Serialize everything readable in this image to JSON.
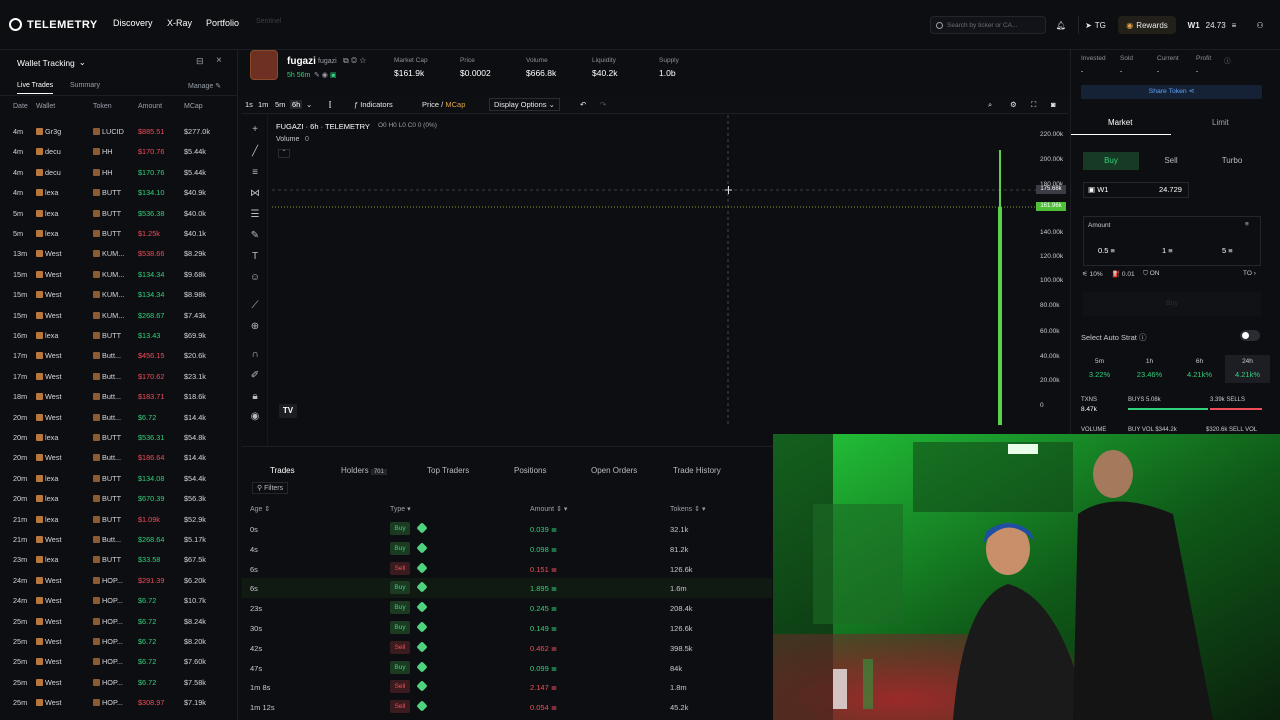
{
  "app": {
    "name": "TELEMETRY"
  },
  "nav": {
    "items": [
      "Discovery",
      "X-Ray",
      "Portfolio"
    ],
    "dim_item": "Sentinel"
  },
  "search": {
    "placeholder": "Search by ticker or CA..."
  },
  "header_right": {
    "tg": "TG",
    "rewards": "Rewards",
    "wallet": "W1",
    "balance": "24.73"
  },
  "wallet_tracking": {
    "title": "Wallet Tracking",
    "tabs": [
      "Live Trades",
      "Summary"
    ],
    "manage": "Manage",
    "columns": [
      "Date",
      "Wallet",
      "Token",
      "Amount",
      "MCap"
    ],
    "rows": [
      {
        "date": "4m",
        "wallet": "Gr3g",
        "token": "LUCID",
        "amount": "$885.51",
        "side": "sell",
        "mcap": "$277.0k"
      },
      {
        "date": "4m",
        "wallet": "decu",
        "token": "HH",
        "amount": "$170.76",
        "side": "sell",
        "mcap": "$5.44k"
      },
      {
        "date": "4m",
        "wallet": "decu",
        "token": "HH",
        "amount": "$170.76",
        "side": "buy",
        "mcap": "$5.44k"
      },
      {
        "date": "4m",
        "wallet": "lexa",
        "token": "BUTT",
        "amount": "$134.10",
        "side": "buy",
        "mcap": "$40.9k"
      },
      {
        "date": "5m",
        "wallet": "lexa",
        "token": "BUTT",
        "amount": "$536.38",
        "side": "buy",
        "mcap": "$40.0k"
      },
      {
        "date": "5m",
        "wallet": "lexa",
        "token": "BUTT",
        "amount": "$1.25k",
        "side": "sell",
        "mcap": "$40.1k"
      },
      {
        "date": "13m",
        "wallet": "West",
        "token": "KUM...",
        "amount": "$538.66",
        "side": "sell",
        "mcap": "$8.29k"
      },
      {
        "date": "15m",
        "wallet": "West",
        "token": "KUM...",
        "amount": "$134.34",
        "side": "buy",
        "mcap": "$9.68k"
      },
      {
        "date": "15m",
        "wallet": "West",
        "token": "KUM...",
        "amount": "$134.34",
        "side": "buy",
        "mcap": "$8.98k"
      },
      {
        "date": "15m",
        "wallet": "West",
        "token": "KUM...",
        "amount": "$268.67",
        "side": "buy",
        "mcap": "$7.43k"
      },
      {
        "date": "16m",
        "wallet": "lexa",
        "token": "BUTT",
        "amount": "$13.43",
        "side": "buy",
        "mcap": "$69.9k"
      },
      {
        "date": "17m",
        "wallet": "West",
        "token": "Butt...",
        "amount": "$456.15",
        "side": "sell",
        "mcap": "$20.6k"
      },
      {
        "date": "17m",
        "wallet": "West",
        "token": "Butt...",
        "amount": "$170.62",
        "side": "sell",
        "mcap": "$23.1k"
      },
      {
        "date": "18m",
        "wallet": "West",
        "token": "Butt...",
        "amount": "$183.71",
        "side": "sell",
        "mcap": "$18.6k"
      },
      {
        "date": "20m",
        "wallet": "West",
        "token": "Butt...",
        "amount": "$6.72",
        "side": "buy",
        "mcap": "$14.4k"
      },
      {
        "date": "20m",
        "wallet": "lexa",
        "token": "BUTT",
        "amount": "$536.31",
        "side": "buy",
        "mcap": "$54.8k"
      },
      {
        "date": "20m",
        "wallet": "West",
        "token": "Butt...",
        "amount": "$186.64",
        "side": "sell",
        "mcap": "$14.4k"
      },
      {
        "date": "20m",
        "wallet": "lexa",
        "token": "BUTT",
        "amount": "$134.08",
        "side": "buy",
        "mcap": "$54.4k"
      },
      {
        "date": "20m",
        "wallet": "lexa",
        "token": "BUTT",
        "amount": "$670.39",
        "side": "buy",
        "mcap": "$56.3k"
      },
      {
        "date": "21m",
        "wallet": "lexa",
        "token": "BUTT",
        "amount": "$1.09k",
        "side": "sell",
        "mcap": "$52.9k"
      },
      {
        "date": "21m",
        "wallet": "West",
        "token": "Butt...",
        "amount": "$268.64",
        "side": "buy",
        "mcap": "$5.17k"
      },
      {
        "date": "23m",
        "wallet": "lexa",
        "token": "BUTT",
        "amount": "$33.58",
        "side": "buy",
        "mcap": "$67.5k"
      },
      {
        "date": "24m",
        "wallet": "West",
        "token": "HOP...",
        "amount": "$291.39",
        "side": "sell",
        "mcap": "$6.20k"
      },
      {
        "date": "24m",
        "wallet": "West",
        "token": "HOP...",
        "amount": "$6.72",
        "side": "buy",
        "mcap": "$10.7k"
      },
      {
        "date": "25m",
        "wallet": "West",
        "token": "HOP...",
        "amount": "$6.72",
        "side": "buy",
        "mcap": "$8.24k"
      },
      {
        "date": "25m",
        "wallet": "West",
        "token": "HOP...",
        "amount": "$6.72",
        "side": "buy",
        "mcap": "$8.20k"
      },
      {
        "date": "25m",
        "wallet": "West",
        "token": "HOP...",
        "amount": "$6.72",
        "side": "buy",
        "mcap": "$7.60k"
      },
      {
        "date": "25m",
        "wallet": "West",
        "token": "HOP...",
        "amount": "$6.72",
        "side": "buy",
        "mcap": "$7.58k"
      },
      {
        "date": "25m",
        "wallet": "West",
        "token": "HOP...",
        "amount": "$308.97",
        "side": "sell",
        "mcap": "$7.19k"
      }
    ]
  },
  "token": {
    "name": "fugazi",
    "ticker": "fugazi",
    "age": "5h 56m",
    "stats": [
      {
        "label": "Market Cap",
        "value": "$161.9k"
      },
      {
        "label": "Price",
        "value": "$0.0002"
      },
      {
        "label": "Volume",
        "value": "$666.8k"
      },
      {
        "label": "Liquidity",
        "value": "$40.2k"
      },
      {
        "label": "Supply",
        "value": "1.0b"
      }
    ]
  },
  "chart_toolbar": {
    "intervals": [
      "1s",
      "1m",
      "5m",
      "6h"
    ],
    "indicators": "Indicators",
    "price": "Price",
    "mcap": "MCap",
    "display": "Display Options"
  },
  "chart": {
    "title": "FUGAZI · 6h · TELEMETRY",
    "ohlc": "O0 H0 L0 C0 0 (0%)",
    "volume_label": "Volume",
    "volume_value": "0",
    "y_ticks": [
      "220.00k",
      "200.00k",
      "180.00k",
      "175.68k",
      "161.96k",
      "140.00k",
      "120.00k",
      "100.00k",
      "80.00k",
      "60.00k",
      "40.00k",
      "20.00k",
      "0"
    ],
    "current_label": "161.96k",
    "crosshair_label": "175.68k"
  },
  "bottom": {
    "tabs": [
      "Trades",
      "Holders",
      "Top Traders",
      "Positions",
      "Open Orders",
      "Trade History"
    ],
    "holders_count": "701",
    "filters": "Filters",
    "columns": [
      "Age",
      "Type",
      "Amount",
      "Tokens"
    ],
    "rows": [
      {
        "age": "0s",
        "type": "Buy",
        "amount": "0.039",
        "tokens": "32.1k"
      },
      {
        "age": "4s",
        "type": "Buy",
        "amount": "0.098",
        "tokens": "81.2k"
      },
      {
        "age": "6s",
        "type": "Sell",
        "amount": "0.151",
        "tokens": "126.6k"
      },
      {
        "age": "6s",
        "type": "Buy",
        "amount": "1.895",
        "tokens": "1.6m"
      },
      {
        "age": "23s",
        "type": "Buy",
        "amount": "0.245",
        "tokens": "208.4k"
      },
      {
        "age": "30s",
        "type": "Buy",
        "amount": "0.149",
        "tokens": "126.6k"
      },
      {
        "age": "42s",
        "type": "Sell",
        "amount": "0.462",
        "tokens": "398.5k"
      },
      {
        "age": "47s",
        "type": "Buy",
        "amount": "0.099",
        "tokens": "84k"
      },
      {
        "age": "1m 8s",
        "type": "Sell",
        "amount": "2.147",
        "tokens": "1.8m"
      },
      {
        "age": "1m 12s",
        "type": "Sell",
        "amount": "0.054",
        "tokens": "45.2k"
      }
    ]
  },
  "trade_panel": {
    "labels": [
      "Invested",
      "Sold",
      "Current",
      "Profit"
    ],
    "values": [
      "-",
      "-",
      "-",
      "-"
    ],
    "share": "Share Token",
    "tabs": [
      "Market",
      "Limit"
    ],
    "modes": [
      "Buy",
      "Sell",
      "Turbo"
    ],
    "wallet": "W1",
    "balance": "24.729",
    "amount_label": "Amount",
    "presets": [
      "0.5",
      "1",
      "5"
    ],
    "settings": [
      "10%",
      "0.01",
      "ON"
    ],
    "to_label": "TO",
    "buy_label": "Buy",
    "autostrat": "Select Auto Strat",
    "periods": [
      {
        "label": "5m",
        "value": "3.22%"
      },
      {
        "label": "1h",
        "value": "23.46%"
      },
      {
        "label": "6h",
        "value": "4.21k%"
      },
      {
        "label": "24h",
        "value": "4.21k%"
      }
    ],
    "txns_label": "TXNS",
    "txns": "8.47k",
    "buys": "BUYS 5.08k",
    "sells": "3.39k SELLS",
    "volume_label": "VOLUME",
    "buy_vol": "BUY VOL $344.2k",
    "sell_vol": "$320.6k SELL VOL"
  }
}
